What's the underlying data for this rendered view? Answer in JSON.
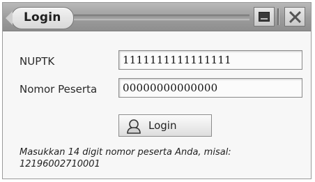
{
  "window": {
    "title": "Login"
  },
  "form": {
    "nuptk_label": "NUPTK",
    "nuptk_value": "1111111111111111",
    "peserta_label": "Nomor Peserta",
    "peserta_value": "00000000000000",
    "login_button_label": "Login",
    "hint_line1": "Masukkan 14 digit nomor peserta Anda, misal:",
    "hint_line2": "12196002710001"
  },
  "icons": {
    "maximize": "maximize-icon",
    "close": "close-icon",
    "login_button": "user-icon"
  }
}
